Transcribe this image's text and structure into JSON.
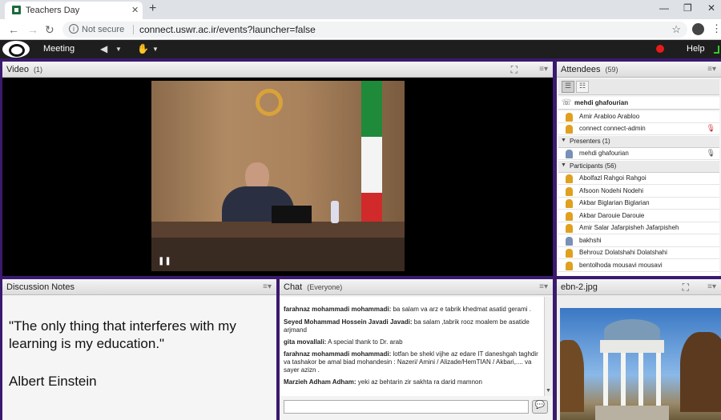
{
  "browser": {
    "tab_title": "Teachers Day",
    "not_secure": "Not secure",
    "url": "connect.uswr.ac.ir/events?launcher=false"
  },
  "menubar": {
    "meeting": "Meeting",
    "help": "Help"
  },
  "video_pod": {
    "title": "Video",
    "count": "(1)"
  },
  "attendees_pod": {
    "title": "Attendees",
    "count": "(59)",
    "current_speaker": "mehdi ghafourian",
    "hosts": [
      "Amir Arabloo Arabloo",
      "connect connect-admin"
    ],
    "presenters_label": "Presenters (1)",
    "presenters": [
      "mehdi ghafourian"
    ],
    "participants_label": "Participants (56)",
    "participants": [
      "Abolfazl Rahgoi Rahgoi",
      "Afsoon Nodehi Nodehi",
      "Akbar Biglarian Biglarian",
      "Akbar Darouie Darouie",
      "Amir Salar Jafarpisheh Jafarpisheh",
      "bakhshi",
      "Behrouz Dolatshahi Dolatshahi",
      "bentolhoda mousavi mousavi"
    ]
  },
  "notes_pod": {
    "title": "Discussion Notes",
    "quote": "\"The only thing that interferes with my learning is my education.\"",
    "author": "Albert Einstein"
  },
  "chat_pod": {
    "title": "Chat",
    "scope": "(Everyone)",
    "messages": [
      {
        "sender": "farahnaz mohammadi mohammadi:",
        "text": " ba salam va arz e tabrik  khedmat asatid gerami ."
      },
      {
        "sender": "Seyed Mohammad Hossein Javadi Javadi:",
        "text": " ba salam ,tabrik rooz moalem be asatide arjmand"
      },
      {
        "sender": "gita movallali:",
        "text": " A special thank to Dr. arab"
      },
      {
        "sender": "farahnaz mohammadi mohammadi:",
        "text": " lotfan be shekl vijhe az edare IT  daneshgah  taghdir va tashakor be amal biad mohandesin :  Nazeri/ Amini / Alizade/HemTIAN / Akbari,.... va sayer azizn ."
      },
      {
        "sender": "Marzieh Adham Adham:",
        "text": " yeki az behtarin zir sakhta ra darid mamnon"
      }
    ]
  },
  "image_pod": {
    "title": "ebn-2.jpg"
  }
}
